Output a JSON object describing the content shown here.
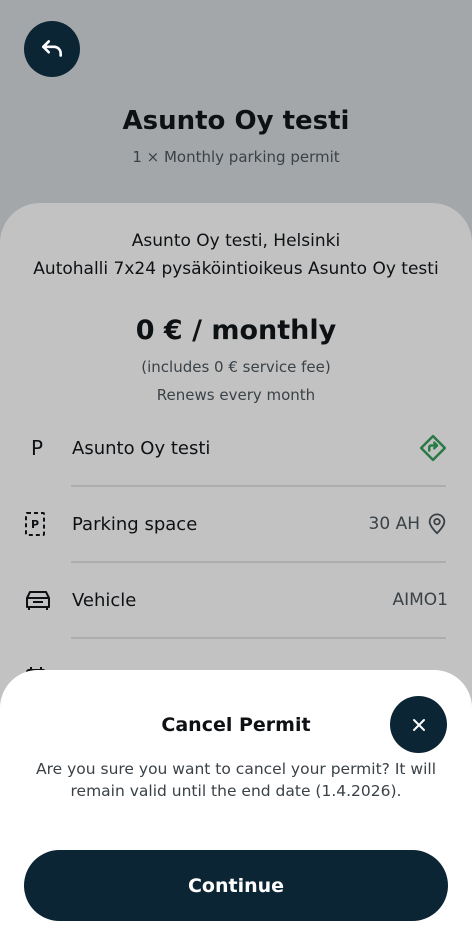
{
  "header": {
    "title": "Asunto Oy testi",
    "subtitle": "1 × Monthly parking permit"
  },
  "card": {
    "address_line1": "Asunto Oy testi, Helsinki",
    "address_line2": "Autohalli 7x24 pysäköintioikeus Asunto Oy testi",
    "price": "0 € / monthly",
    "fee": "(includes 0 € service fee)",
    "renewal": "Renews every month"
  },
  "details": [
    {
      "icon": "parking-p-icon",
      "label": "Asunto Oy testi",
      "value": "",
      "action_icon": "directions-icon"
    },
    {
      "icon": "parking-space-icon",
      "label": "Parking space",
      "value": "30 AH",
      "action_icon": "location-pin-icon"
    },
    {
      "icon": "car-icon",
      "label": "Vehicle",
      "value": "AIMO1"
    }
  ],
  "dialog": {
    "title": "Cancel Permit",
    "message": "Are you sure you want to cancel your permit? It will remain valid until the end date (1.4.2026).",
    "continue_label": "Continue"
  },
  "colors": {
    "primary": "#0c2535",
    "accent_green": "#2a7a45"
  }
}
